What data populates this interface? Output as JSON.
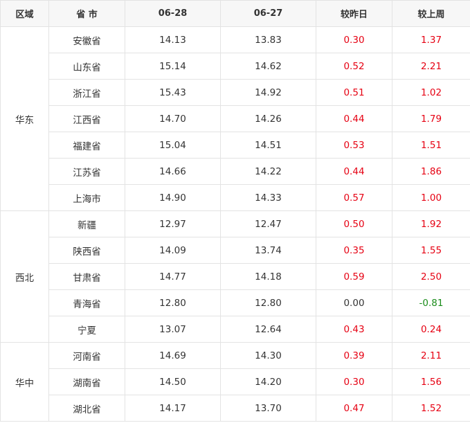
{
  "headers": {
    "region": "区域",
    "province": "省 市",
    "date1": "06-28",
    "date2": "06-27",
    "vs_yesterday": "较昨日",
    "vs_last_week": "较上周"
  },
  "colors": {
    "up": "#e60012",
    "down": "#1a8c1a",
    "flat": "#333333"
  },
  "groups": [
    {
      "region": "华东",
      "rows": [
        {
          "province": "安徽省",
          "d1": "14.13",
          "d2": "13.83",
          "dy": "0.30",
          "dw": "1.37",
          "dy_dir": "up",
          "dw_dir": "up"
        },
        {
          "province": "山东省",
          "d1": "15.14",
          "d2": "14.62",
          "dy": "0.52",
          "dw": "2.21",
          "dy_dir": "up",
          "dw_dir": "up"
        },
        {
          "province": "浙江省",
          "d1": "15.43",
          "d2": "14.92",
          "dy": "0.51",
          "dw": "1.02",
          "dy_dir": "up",
          "dw_dir": "up"
        },
        {
          "province": "江西省",
          "d1": "14.70",
          "d2": "14.26",
          "dy": "0.44",
          "dw": "1.79",
          "dy_dir": "up",
          "dw_dir": "up"
        },
        {
          "province": "福建省",
          "d1": "15.04",
          "d2": "14.51",
          "dy": "0.53",
          "dw": "1.51",
          "dy_dir": "up",
          "dw_dir": "up"
        },
        {
          "province": "江苏省",
          "d1": "14.66",
          "d2": "14.22",
          "dy": "0.44",
          "dw": "1.86",
          "dy_dir": "up",
          "dw_dir": "up"
        },
        {
          "province": "上海市",
          "d1": "14.90",
          "d2": "14.33",
          "dy": "0.57",
          "dw": "1.00",
          "dy_dir": "up",
          "dw_dir": "up"
        }
      ]
    },
    {
      "region": "西北",
      "rows": [
        {
          "province": "新疆",
          "d1": "12.97",
          "d2": "12.47",
          "dy": "0.50",
          "dw": "1.92",
          "dy_dir": "up",
          "dw_dir": "up"
        },
        {
          "province": "陕西省",
          "d1": "14.09",
          "d2": "13.74",
          "dy": "0.35",
          "dw": "1.55",
          "dy_dir": "up",
          "dw_dir": "up"
        },
        {
          "province": "甘肃省",
          "d1": "14.77",
          "d2": "14.18",
          "dy": "0.59",
          "dw": "2.50",
          "dy_dir": "up",
          "dw_dir": "up"
        },
        {
          "province": "青海省",
          "d1": "12.80",
          "d2": "12.80",
          "dy": "0.00",
          "dw": "-0.81",
          "dy_dir": "flat",
          "dw_dir": "down"
        },
        {
          "province": "宁夏",
          "d1": "13.07",
          "d2": "12.64",
          "dy": "0.43",
          "dw": "0.24",
          "dy_dir": "up",
          "dw_dir": "up"
        }
      ]
    },
    {
      "region": "华中",
      "rows": [
        {
          "province": "河南省",
          "d1": "14.69",
          "d2": "14.30",
          "dy": "0.39",
          "dw": "2.11",
          "dy_dir": "up",
          "dw_dir": "up"
        },
        {
          "province": "湖南省",
          "d1": "14.50",
          "d2": "14.20",
          "dy": "0.30",
          "dw": "1.56",
          "dy_dir": "up",
          "dw_dir": "up"
        },
        {
          "province": "湖北省",
          "d1": "14.17",
          "d2": "13.70",
          "dy": "0.47",
          "dw": "1.52",
          "dy_dir": "up",
          "dw_dir": "up"
        }
      ]
    }
  ]
}
